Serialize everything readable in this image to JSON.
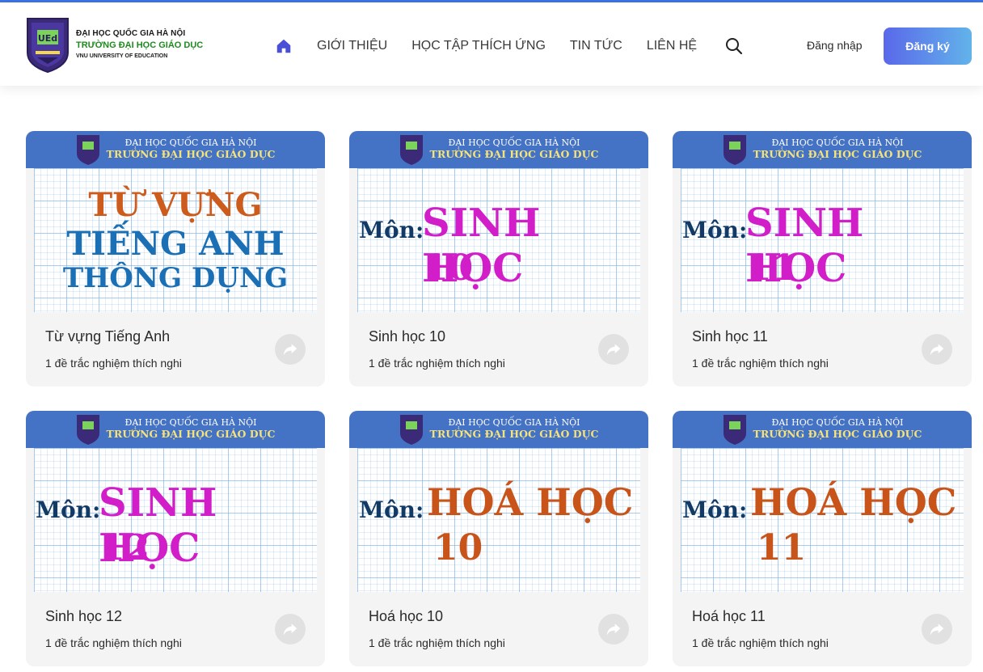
{
  "header": {
    "logo": {
      "line1": "ĐẠI HỌC QUỐC GIA HÀ NỘI",
      "line2": "TRƯỜNG ĐẠI HỌC GIÁO DỤC",
      "line3": "VNU UNIVERSITY OF EDUCATION",
      "emblem_text": "UEd"
    },
    "nav": [
      {
        "label": "GIỚI THIỆU"
      },
      {
        "label": "HỌC TẬP THÍCH ỨNG"
      },
      {
        "label": "TIN TỨC"
      },
      {
        "label": "LIÊN HỆ"
      }
    ],
    "login_label": "Đăng nhập",
    "register_label": "Đăng ký"
  },
  "thumbnail_band": {
    "line1": "ĐẠI HỌC QUỐC GIA HÀ NỘI",
    "line2": "TRƯỜNG ĐẠI HỌC GIÁO DỤC"
  },
  "courses": [
    {
      "title": "Từ vựng Tiếng Anh",
      "meta": "1 đề trắc nghiệm thích nghi",
      "thumb": {
        "line1": "TỪ VỰNG",
        "line2": "TIẾNG ANH",
        "line3": "THÔNG DỤNG"
      }
    },
    {
      "title": "Sinh học 10",
      "meta": "1 đề trắc nghiệm thích nghi",
      "thumb": {
        "prefix": "Môn:",
        "subject": "SINH HỌC",
        "grade": "10"
      }
    },
    {
      "title": "Sinh học 11",
      "meta": "1 đề trắc nghiệm thích nghi",
      "thumb": {
        "prefix": "Môn:",
        "subject": "SINH HỌC",
        "grade": "11"
      }
    },
    {
      "title": "Sinh học 12",
      "meta": "1 đề trắc nghiệm thích nghi",
      "thumb": {
        "prefix": "Môn:",
        "subject": "SINH HỌC",
        "grade": "12"
      }
    },
    {
      "title": "Hoá học 10",
      "meta": "1 đề trắc nghiệm thích nghi",
      "thumb": {
        "prefix": "Môn:",
        "subject": "HOÁ HỌC",
        "grade": "10"
      }
    },
    {
      "title": "Hoá học 11",
      "meta": "1 đề trắc nghiệm thích nghi",
      "thumb": {
        "prefix": "Môn:",
        "subject": "HOÁ HỌC",
        "grade": "11"
      }
    }
  ],
  "colors": {
    "accent": "#3b73e6",
    "register_gradient_start": "#5a68ea",
    "register_gradient_end": "#62b3ea",
    "thumb_band": "#4472c4",
    "biology_subject": "#d21ec8",
    "chemistry_subject": "#c8541a",
    "card_background": "#f4f4f4"
  }
}
